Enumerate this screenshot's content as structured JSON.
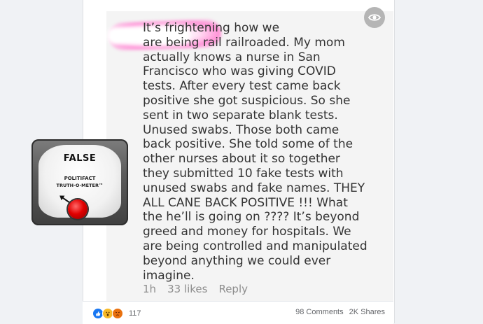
{
  "post": {
    "text": "It’s frightening how we\nare being rail railroaded. My mom\nactually knows a nurse in San\nFrancisco who was giving COVID\ntests. After every test came back\npositive she got suspicious. So she\nsent in two separate blank tests.\nUnused swabs. Those both came\nback positive. She told some of the\nother nurses about it so together\nthey submitted 10 fake tests with\nunused swabs and fake names. THEY\nALL CANE BACK POSITIVE !!! What\nthe he’ll is going on ???? It’s beyond\ngreed and money for hospitals. We\nare being controlled and manipulated\nbeyond anything we could ever\nimagine.",
    "comment_time": "1h",
    "comment_likes": "33 likes",
    "comment_reply": "Reply"
  },
  "meter": {
    "verdict": "FALSE",
    "brand_line1": "POLITIFACT",
    "brand_line2": "TRUTH-O-METER™"
  },
  "footer": {
    "reactions_count": "117",
    "comments": "98 Comments",
    "shares": "2K Shares"
  },
  "icons": {
    "visibility": "eye-icon",
    "reactions": [
      "like-icon",
      "wow-icon",
      "angry-icon"
    ]
  },
  "colors": {
    "like": "#1877f2",
    "wow": "#f7b928",
    "angry": "#e9710f",
    "meter_knob": "#e20000",
    "redaction_glow": "#ff8fd6"
  }
}
